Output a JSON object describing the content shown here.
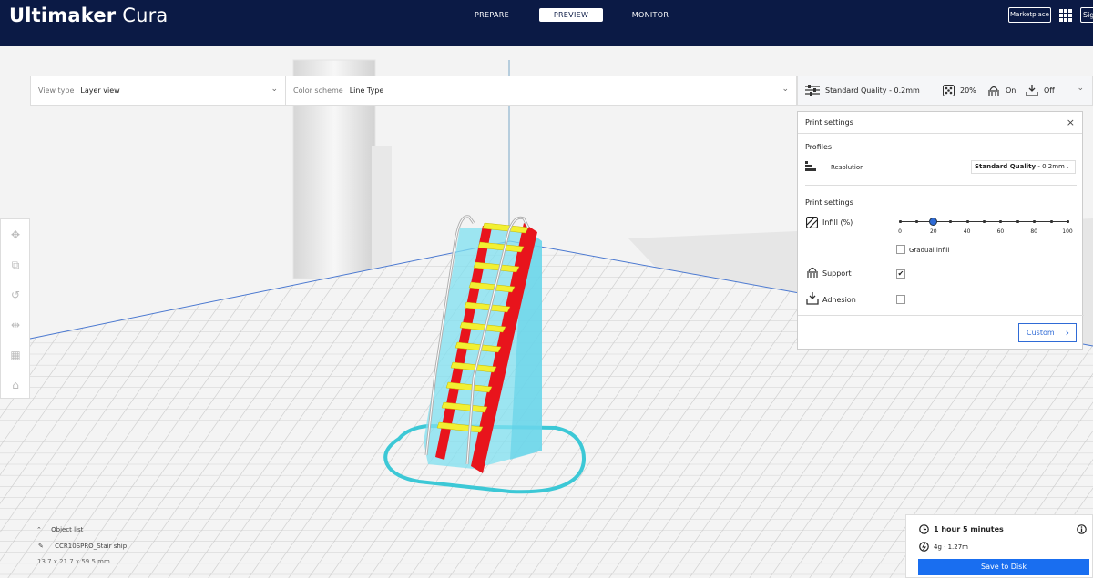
{
  "header": {
    "brand_bold": "Ultimaker",
    "brand_light": " Cura",
    "stages": [
      "PREPARE",
      "PREVIEW",
      "MONITOR"
    ],
    "active_stage": "PREVIEW",
    "marketplace": "Marketplace",
    "signin": "Sig"
  },
  "toolbar": {
    "view_type_label": "View type",
    "view_type_value": "Layer view",
    "color_scheme_label": "Color scheme",
    "color_scheme_value": "Line Type"
  },
  "quality_bar": {
    "profile": "Standard Quality - 0.2mm",
    "infill": "20%",
    "support": "On",
    "adhesion": "Off"
  },
  "print_settings": {
    "title": "Print settings",
    "close": "×",
    "profiles_heading": "Profiles",
    "resolution_label": "Resolution",
    "resolution_bold": "Standard Quality",
    "resolution_rest": " - 0.2mm",
    "settings_heading": "Print settings",
    "infill_label": "Infill (%)",
    "infill_value_percent": 20,
    "infill_ticks": [
      "0",
      "20",
      "40",
      "60",
      "80",
      "100"
    ],
    "gradual_infill_label": "Gradual infill",
    "support_label": "Support",
    "support_checked": true,
    "adhesion_label": "Adhesion",
    "adhesion_checked": false,
    "custom_button": "Custom"
  },
  "object_list": {
    "title": "Object list",
    "object_name": "CCR10SPRO_Stair ship",
    "dimensions": "13.7 x 21.7 x 59.5 mm"
  },
  "estimate": {
    "time": "1 hour 5 minutes",
    "material": "4g · 1.27m",
    "save_button": "Save to Disk"
  },
  "colors": {
    "header_bg": "#0b1a45",
    "accent": "#196ef0",
    "wall_outer": "#e8141c",
    "infill": "#7fe0f0",
    "top_bottom": "#f2f032"
  }
}
